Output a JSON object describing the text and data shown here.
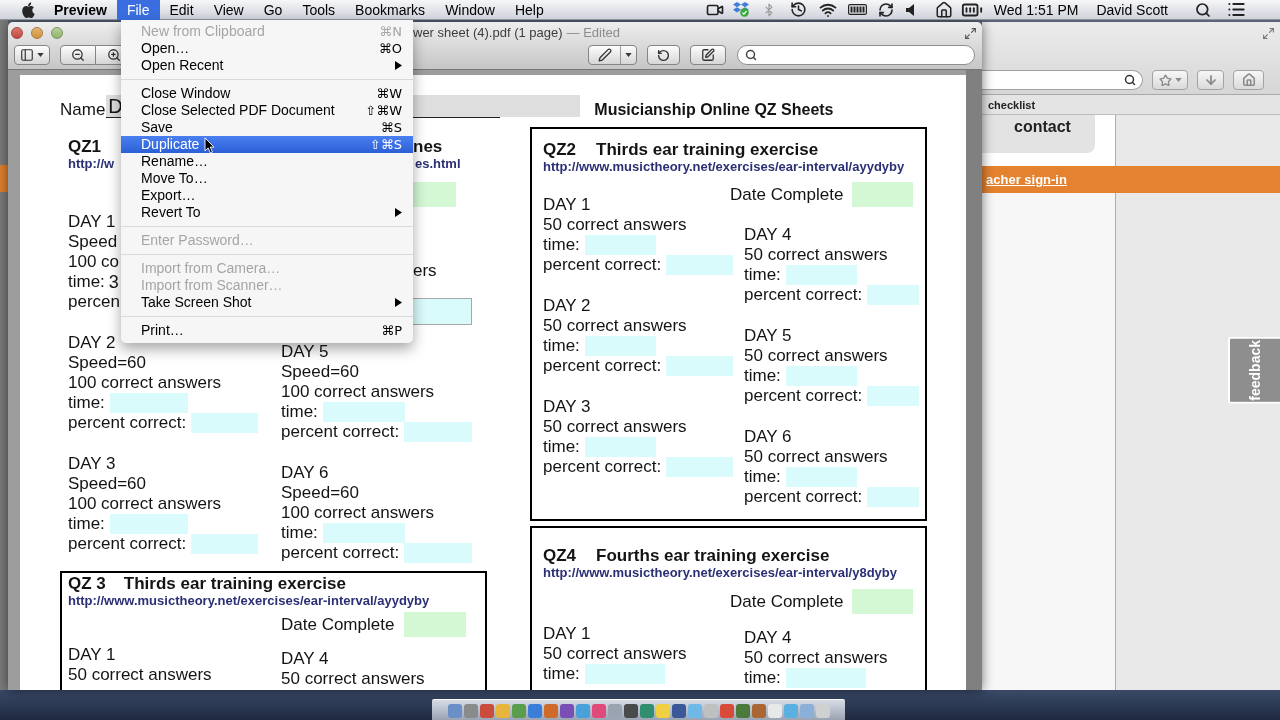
{
  "menu_bar": {
    "app_name": "Preview",
    "menus": [
      {
        "label": "File",
        "selected": true
      },
      {
        "label": "Edit",
        "selected": false
      },
      {
        "label": "View",
        "selected": false
      },
      {
        "label": "Go",
        "selected": false
      },
      {
        "label": "Tools",
        "selected": false
      },
      {
        "label": "Bookmarks",
        "selected": false
      },
      {
        "label": "Window",
        "selected": false
      },
      {
        "label": "Help",
        "selected": false
      }
    ],
    "clock": "Wed 1:51 PM",
    "user": "David Scott"
  },
  "file_menu": [
    {
      "kind": "item",
      "label": "New from Clipboard",
      "shortcut": "⌘N",
      "disabled": true,
      "selected": false,
      "submenu": false
    },
    {
      "kind": "item",
      "label": "Open…",
      "shortcut": "⌘O",
      "disabled": false,
      "selected": false,
      "submenu": false
    },
    {
      "kind": "item",
      "label": "Open Recent",
      "disabled": false,
      "selected": false,
      "submenu": true
    },
    {
      "kind": "separator"
    },
    {
      "kind": "item",
      "label": "Close Window",
      "shortcut": "⌘W",
      "disabled": false,
      "selected": false,
      "submenu": false
    },
    {
      "kind": "item",
      "label": "Close Selected PDF Document",
      "shortcut": "⇧⌘W",
      "disabled": false,
      "selected": false,
      "submenu": false
    },
    {
      "kind": "item",
      "label": "Save",
      "shortcut": "⌘S",
      "disabled": false,
      "selected": false,
      "submenu": false
    },
    {
      "kind": "item",
      "label": "Duplicate",
      "shortcut": "⇧⌘S",
      "disabled": false,
      "selected": true,
      "submenu": false
    },
    {
      "kind": "item",
      "label": "Rename…",
      "disabled": false,
      "selected": false,
      "submenu": false
    },
    {
      "kind": "item",
      "label": "Move To…",
      "disabled": false,
      "selected": false,
      "submenu": false
    },
    {
      "kind": "item",
      "label": "Export…",
      "disabled": false,
      "selected": false,
      "submenu": false
    },
    {
      "kind": "item",
      "label": "Revert To",
      "disabled": false,
      "selected": false,
      "submenu": true
    },
    {
      "kind": "separator"
    },
    {
      "kind": "item",
      "label": "Enter Password…",
      "disabled": true,
      "selected": false,
      "submenu": false
    },
    {
      "kind": "separator"
    },
    {
      "kind": "item",
      "label": "Import from Camera…",
      "disabled": true,
      "selected": false,
      "submenu": false
    },
    {
      "kind": "item",
      "label": "Import from Scanner…",
      "disabled": true,
      "selected": false,
      "submenu": false
    },
    {
      "kind": "item",
      "label": "Take Screen Shot",
      "disabled": false,
      "selected": false,
      "submenu": true
    },
    {
      "kind": "separator"
    },
    {
      "kind": "item",
      "label": "Print…",
      "shortcut": "⌘P",
      "disabled": false,
      "selected": false,
      "submenu": false
    }
  ],
  "preview_window": {
    "title": "wer sheet (4).pdf (1 page)",
    "edited_label": "— Edited"
  },
  "document": {
    "name_label": "Name",
    "name_value": "D",
    "heading": "Musicianship Online QZ Sheets",
    "qz1": {
      "code": "QZ1",
      "title_tail": "nes",
      "url_head": "http://w",
      "url_tail": "es.html",
      "answers_tail": "ers",
      "left_days": [
        {
          "kind": "cut",
          "day": "DAY 1",
          "speed": "Speed",
          "answers": "100 co",
          "time": "time:",
          "time_value": "3",
          "percent": "percen"
        },
        {
          "kind": "full",
          "day": "DAY 2",
          "speed": "Speed=60",
          "answers": "100 correct answers",
          "time": "time:",
          "percent": "percent correct:"
        },
        {
          "kind": "full",
          "day": "DAY 3",
          "speed": "Speed=60",
          "answers": "100 correct answers",
          "time": "time:",
          "percent": "percent correct:"
        }
      ],
      "right_days": [
        {
          "kind": "full",
          "day": "DAY 5",
          "speed": "Speed=60",
          "answers": "100 correct answers",
          "time": "time:",
          "percent": "percent correct:"
        },
        {
          "kind": "full",
          "day": "DAY 6",
          "speed": "Speed=60",
          "answers": "100 correct answers",
          "time": "time:",
          "percent": "percent correct:"
        }
      ]
    },
    "sections": [
      {
        "code": "QZ2",
        "title": "Thirds ear training exercise",
        "url": "http://www.musictheory.net/exercises/ear-interval/ayydyby",
        "date_label": "Date Complete",
        "left_days": [
          {
            "kind": "full",
            "day": "DAY 1",
            "answers": "50 correct answers",
            "time": "time:",
            "percent": "percent correct:"
          },
          {
            "kind": "full",
            "day": "DAY 2",
            "answers": "50 correct answers",
            "time": "time:",
            "percent": "percent correct:"
          },
          {
            "kind": "full",
            "day": "DAY 3",
            "answers": "50 correct answers",
            "time": "time:",
            "percent": "percent correct:"
          }
        ],
        "right_days": [
          {
            "kind": "full",
            "day": "DAY 4",
            "answers": "50 correct answers",
            "time": "time:",
            "percent": "percent correct:"
          },
          {
            "kind": "full",
            "day": "DAY 5",
            "answers": "50 correct answers",
            "time": "time:",
            "percent": "percent correct:"
          },
          {
            "kind": "full",
            "day": "DAY 6",
            "answers": "50 correct answers",
            "time": "time:",
            "percent": "percent correct:"
          }
        ]
      },
      {
        "code": "QZ 3",
        "title": "Thirds ear training exercise",
        "url": "http://www.musictheory.net/exercises/ear-interval/ayydyby",
        "date_label": "Date Complete",
        "left_days": [
          {
            "kind": "full",
            "day": "DAY 1",
            "answers": "50 correct answers"
          }
        ],
        "right_days": [
          {
            "kind": "full",
            "day": "DAY 4",
            "answers": "50 correct answers"
          }
        ]
      },
      {
        "code": "QZ4",
        "title": "Fourths ear training exercise",
        "url": "http://www.musictheory.net/exercises/ear-interval/y8dyby",
        "date_label": "Date Complete",
        "left_days": [
          {
            "kind": "full",
            "day": "DAY 1",
            "answers": "50 correct answers",
            "time": "time:"
          }
        ],
        "right_days": [
          {
            "kind": "full",
            "day": "DAY 4",
            "answers": "50 correct answers",
            "time": "time:"
          }
        ]
      }
    ]
  },
  "browser_window": {
    "bookmark": "checklist",
    "card_text": "contact",
    "banner_link": "acher sign-in",
    "feedback_tab": "feedback"
  }
}
